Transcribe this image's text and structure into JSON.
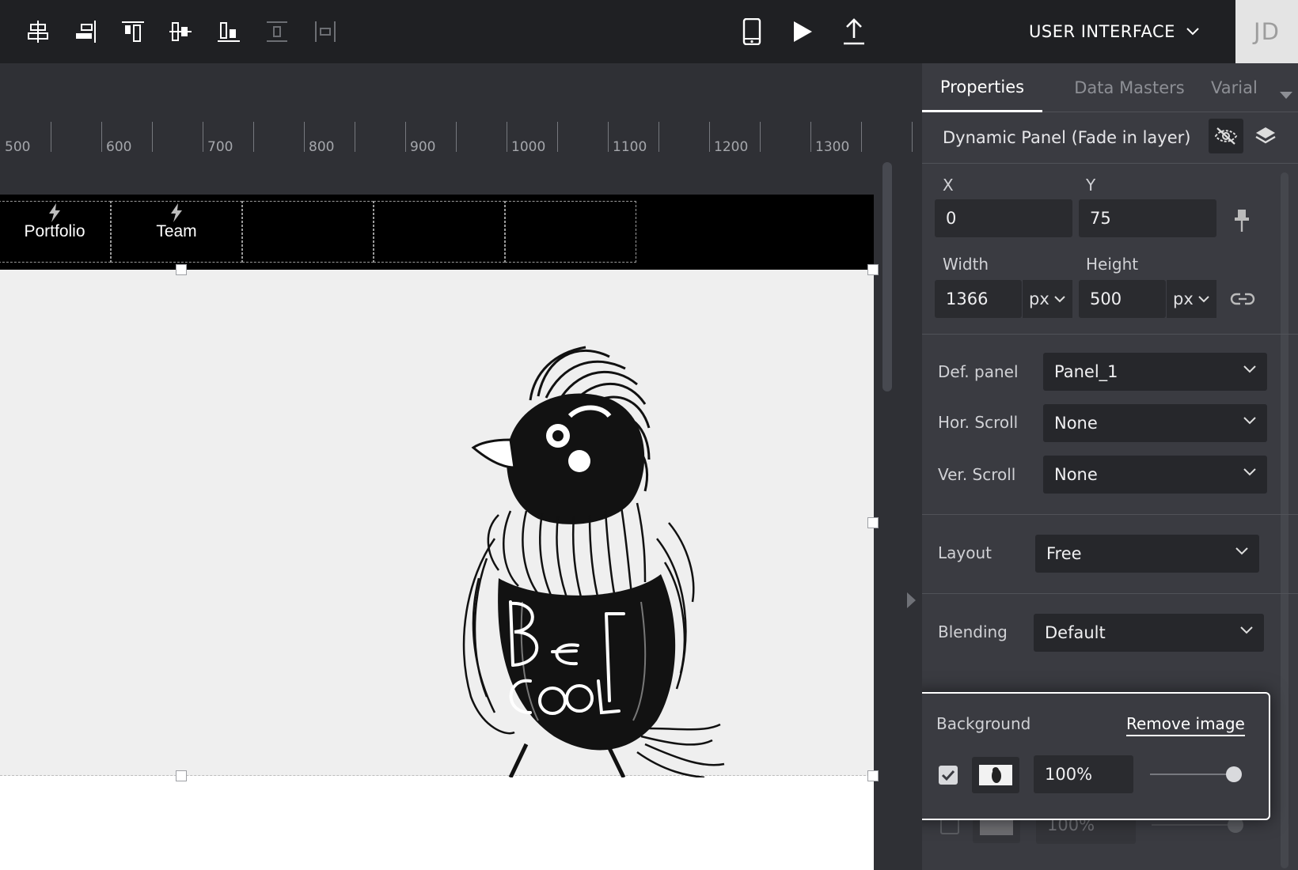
{
  "toolbar": {
    "tools": [
      {
        "name": "align-center-horizontal-icon"
      },
      {
        "name": "align-right-icon"
      },
      {
        "name": "align-top-icon"
      },
      {
        "name": "align-middle-vertical-icon"
      },
      {
        "name": "align-bottom-icon"
      },
      {
        "name": "distribute-vertical-icon"
      },
      {
        "name": "distribute-horizontal-icon"
      }
    ],
    "actions": [
      {
        "name": "mobile-preview-icon"
      },
      {
        "name": "play-icon"
      },
      {
        "name": "upload-icon"
      }
    ],
    "mode_label": "USER INTERFACE",
    "avatar_initials": "JD"
  },
  "ruler": {
    "labels": [
      "500",
      "600",
      "700",
      "800",
      "900",
      "1000",
      "1100",
      "1200",
      "1300"
    ]
  },
  "navbar": {
    "items": [
      "Portfolio",
      "Team",
      "",
      "",
      ""
    ]
  },
  "properties": {
    "tabs": [
      "Properties",
      "Data Masters",
      "Varial"
    ],
    "active_tab": "Properties",
    "selected_title": "Dynamic Panel (Fade in layer)",
    "position": {
      "x_label": "X",
      "x_value": "0",
      "y_label": "Y",
      "y_value": "75"
    },
    "size": {
      "width_label": "Width",
      "width_value": "1366",
      "width_unit": "px",
      "height_label": "Height",
      "height_value": "500",
      "height_unit": "px"
    },
    "def_panel": {
      "label": "Def. panel",
      "value": "Panel_1"
    },
    "hor_scroll": {
      "label": "Hor. Scroll",
      "value": "None"
    },
    "ver_scroll": {
      "label": "Ver. Scroll",
      "value": "None"
    },
    "layout": {
      "label": "Layout",
      "value": "Free"
    },
    "blending": {
      "label": "Blending",
      "value": "Default"
    },
    "background": {
      "label": "Background",
      "remove_label": "Remove image",
      "layers": [
        {
          "enabled": true,
          "opacity": "100%",
          "slider": 1.0
        },
        {
          "enabled": false,
          "opacity": "100%",
          "slider": 1.0
        }
      ]
    }
  },
  "colors": {
    "toolbar_bg": "#1f2023",
    "panel_bg": "#3a3b41",
    "canvas_bg": "#2f3035",
    "accent": "#ffffff"
  }
}
